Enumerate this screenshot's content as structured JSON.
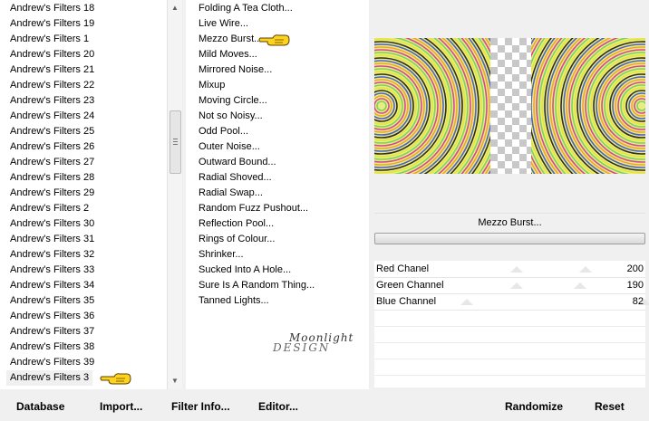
{
  "category_list": {
    "items": [
      "Andrew's Filters 18",
      "Andrew's Filters 19",
      "Andrew's Filters 1",
      "Andrew's Filters 20",
      "Andrew's Filters 21",
      "Andrew's Filters 22",
      "Andrew's Filters 23",
      "Andrew's Filters 24",
      "Andrew's Filters 25",
      "Andrew's Filters 26",
      "Andrew's Filters 27",
      "Andrew's Filters 28",
      "Andrew's Filters 29",
      "Andrew's Filters 2",
      "Andrew's Filters 30",
      "Andrew's Filters 31",
      "Andrew's Filters 32",
      "Andrew's Filters 33",
      "Andrew's Filters 34",
      "Andrew's Filters 35",
      "Andrew's Filters 36",
      "Andrew's Filters 37",
      "Andrew's Filters 38",
      "Andrew's Filters 39",
      "Andrew's Filters 3"
    ],
    "selected_index": 24
  },
  "filter_list": {
    "items": [
      "Folding A Tea Cloth...",
      "Live Wire...",
      "Mezzo Burst...",
      "Mild Moves...",
      "Mirrored Noise...",
      "Mixup",
      "Moving Circle...",
      "Not so Noisy...",
      "Odd Pool...",
      "Outer Noise...",
      "Outward Bound...",
      "Radial Shoved...",
      "Radial Swap...",
      "Random Fuzz Pushout...",
      "Reflection Pool...",
      "Rings of Colour...",
      "Shrinker...",
      "Sucked Into A Hole...",
      "Sure Is A Random Thing...",
      "Tanned Lights..."
    ],
    "pointed_index": 2
  },
  "watermark": {
    "script": "Moonlight",
    "text": "DESIGN"
  },
  "filter_name": "Mezzo Burst...",
  "progress": 0,
  "params": [
    {
      "label": "Red Chanel",
      "value": "200"
    },
    {
      "label": "Green Channel",
      "value": "190"
    },
    {
      "label": "Blue Channel",
      "value": "82"
    }
  ],
  "buttons": {
    "database": "Database",
    "import": "Import...",
    "filter_info": "Filter Info...",
    "editor": "Editor...",
    "randomize": "Randomize",
    "reset": "Reset"
  },
  "icons": {
    "hand": "pointing-hand-icon",
    "scroll_up": "scroll-up-arrow-icon",
    "scroll_down": "scroll-down-arrow-icon"
  },
  "colors": {
    "hand_fill": "#ffd21f",
    "ring_colors": [
      "#e2e53a",
      "#78d36b",
      "#d3479b",
      "#f0a23a",
      "#4a63c9",
      "#2c2c2c"
    ]
  }
}
